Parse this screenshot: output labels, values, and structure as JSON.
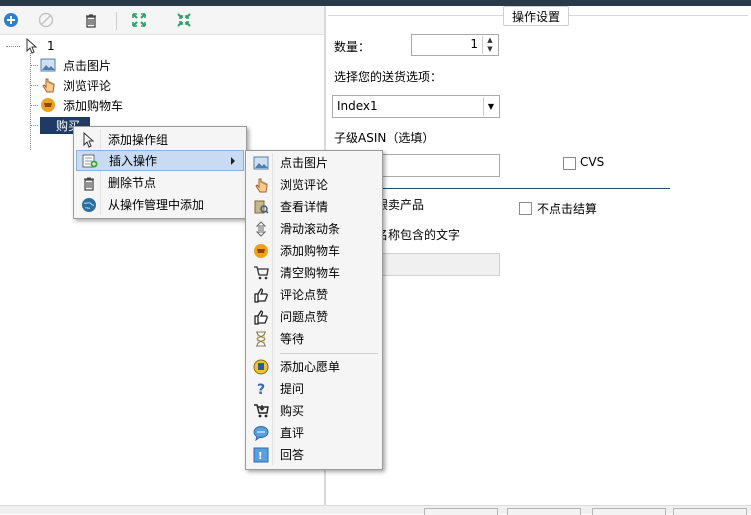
{
  "toolbar": {
    "buttons": [
      "add-icon",
      "disable-icon",
      "trash-icon",
      "expand-icon",
      "collapse-icon"
    ]
  },
  "tree": {
    "root": "1",
    "nodes": [
      "点击图片",
      "浏览评论",
      "添加购物车",
      "购买"
    ]
  },
  "panel": {
    "title": "操作设置",
    "qty_label": "数量：",
    "qty_value": "1",
    "shipping_label": "选择您的送货选项：",
    "shipping_value": "Index1",
    "asin_label": "子级ASIN（选填）",
    "cvs_label": "CVS",
    "track_label": "跟卖产品",
    "no_checkout_label": "不点击结算",
    "name_contains_label": "名称包含的文字"
  },
  "menu": {
    "items": [
      "添加操作组",
      "插入操作",
      "删除节点",
      "从操作管理中添加"
    ]
  },
  "submenu": {
    "items": [
      "点击图片",
      "浏览评论",
      "查看详情",
      "滑动滚动条",
      "添加购物车",
      "清空购物车",
      "评论点赞",
      "问题点赞",
      "等待",
      "添加心愿单",
      "提问",
      "购买",
      "直评",
      "回答"
    ]
  },
  "colors": {
    "selection": "#1f3a63",
    "menu_highlight": "#c8dbf2",
    "divider": "#2d4a62"
  }
}
